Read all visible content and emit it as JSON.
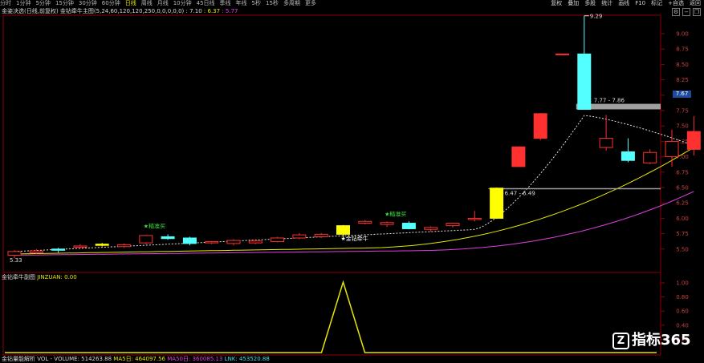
{
  "toolbar": {
    "tabs": [
      "分时",
      "1分钟",
      "5分钟",
      "15分钟",
      "30分钟",
      "60分钟",
      "日线",
      "周线",
      "月线",
      "10分钟",
      "45日线",
      "季线",
      "年线",
      "5秒",
      "15秒",
      "多周期",
      "更多"
    ],
    "active_index": 6,
    "right_buttons": [
      "复权",
      "叠加",
      "多股",
      "统计",
      "画线",
      "F10",
      "标记",
      "+自选",
      "返回"
    ]
  },
  "header": {
    "title": "金姿决选(日线,前复权)",
    "indicator_name": "金钻牵牛主图",
    "indicator_params": "(5,24,60,120,120,250,0,0,0,0,0)",
    "val1": ": 7.10",
    "val2": ": 6.37",
    "val3": ": 5.77",
    "val1_color": "#d8d8d8",
    "val2_color": "#e6e600",
    "val3_color": "#e040e0"
  },
  "sub_indicator": {
    "name": "金钻牵牛副图",
    "field": "JINZUAN: 0.00"
  },
  "volume_bar": {
    "name": "金钻量能解析",
    "vol_label": "VOL - VOLUME: 514263.88",
    "ma5_label": "MA5日: 464097.56",
    "ma50_label": "MA50日: 360085.13",
    "link_label": "LNK: 453520.88"
  },
  "price_axis": [
    "9.00",
    "8.75",
    "8.50",
    "8.25",
    "8.00",
    "7.75",
    "7.50",
    "7.25",
    "7.00",
    "6.75",
    "6.50",
    "6.25",
    "6.00",
    "5.75",
    "5.50"
  ],
  "sub_axis": [
    "1.00",
    "0.80",
    "0.60",
    "0.40",
    "0.20"
  ],
  "current_price": "7.67",
  "annotations": {
    "high": "9.29",
    "low": "5.33",
    "zone1": "7.77 - 7.86",
    "zone2": "6.47 - 6.49"
  },
  "signals": [
    "★精准买",
    "★精准买",
    "★金钻牵牛"
  ],
  "logo": {
    "icon": "Z",
    "text": "指标365"
  },
  "colors": {
    "up": "#ff3030",
    "down": "#54ffff",
    "yellow": "#ffff00",
    "ma_white": "#e0e0e0",
    "ma_yellow": "#e6e600",
    "ma_magenta": "#e040e0"
  },
  "candles": [
    {
      "o": 5.4,
      "c": 5.46,
      "h": 5.48,
      "l": 5.35
    },
    {
      "o": 5.44,
      "c": 5.47,
      "h": 5.5,
      "l": 5.42
    },
    {
      "o": 5.5,
      "c": 5.48,
      "h": 5.52,
      "l": 5.44
    },
    {
      "o": 5.53,
      "c": 5.55,
      "h": 5.58,
      "l": 5.51
    },
    {
      "o": 5.56,
      "c": 5.58,
      "h": 5.6,
      "l": 5.54,
      "y": true
    },
    {
      "o": 5.54,
      "c": 5.57,
      "h": 5.59,
      "l": 5.52
    },
    {
      "o": 5.6,
      "c": 5.72,
      "h": 5.73,
      "l": 5.58
    },
    {
      "o": 5.7,
      "c": 5.67,
      "h": 5.74,
      "l": 5.65
    },
    {
      "o": 5.68,
      "c": 5.59,
      "h": 5.7,
      "l": 5.56
    },
    {
      "o": 5.6,
      "c": 5.62,
      "h": 5.63,
      "l": 5.58
    },
    {
      "o": 5.59,
      "c": 5.64,
      "h": 5.66,
      "l": 5.56
    },
    {
      "o": 5.6,
      "c": 5.63,
      "h": 5.66,
      "l": 5.58
    },
    {
      "o": 5.62,
      "c": 5.68,
      "h": 5.7,
      "l": 5.61
    },
    {
      "o": 5.68,
      "c": 5.73,
      "h": 5.76,
      "l": 5.66
    },
    {
      "o": 5.7,
      "c": 5.74,
      "h": 5.76,
      "l": 5.68
    },
    {
      "o": 5.74,
      "c": 5.88,
      "h": 5.89,
      "l": 5.7,
      "y": true
    },
    {
      "o": 5.92,
      "c": 5.95,
      "h": 5.97,
      "l": 5.9
    },
    {
      "o": 5.9,
      "c": 5.93,
      "h": 5.95,
      "l": 5.86
    },
    {
      "o": 5.92,
      "c": 5.83,
      "h": 5.95,
      "l": 5.82
    },
    {
      "o": 5.82,
      "c": 5.85,
      "h": 5.87,
      "l": 5.78
    },
    {
      "o": 5.88,
      "c": 5.92,
      "h": 5.93,
      "l": 5.85
    },
    {
      "o": 5.98,
      "c": 6.0,
      "h": 6.12,
      "l": 5.95
    },
    {
      "o": 6.0,
      "c": 6.49,
      "h": 6.5,
      "l": 5.99,
      "y": true
    },
    {
      "o": 6.84,
      "c": 7.16,
      "h": 7.17,
      "l": 6.84
    },
    {
      "o": 7.3,
      "c": 7.7,
      "h": 7.71,
      "l": 7.27
    },
    {
      "o": 8.66,
      "c": 8.67,
      "h": 8.67,
      "l": 8.66
    },
    {
      "o": 8.67,
      "c": 7.77,
      "h": 9.29,
      "l": 7.77
    },
    {
      "o": 7.15,
      "c": 7.3,
      "h": 7.68,
      "l": 7.1
    },
    {
      "o": 7.08,
      "c": 6.94,
      "h": 7.3,
      "l": 6.91
    },
    {
      "o": 6.9,
      "c": 7.07,
      "h": 7.12,
      "l": 6.88
    },
    {
      "o": 7.0,
      "c": 7.25,
      "h": 7.44,
      "l": 6.84
    },
    {
      "o": 7.12,
      "c": 7.41,
      "h": 7.66,
      "l": 7.02
    }
  ]
}
